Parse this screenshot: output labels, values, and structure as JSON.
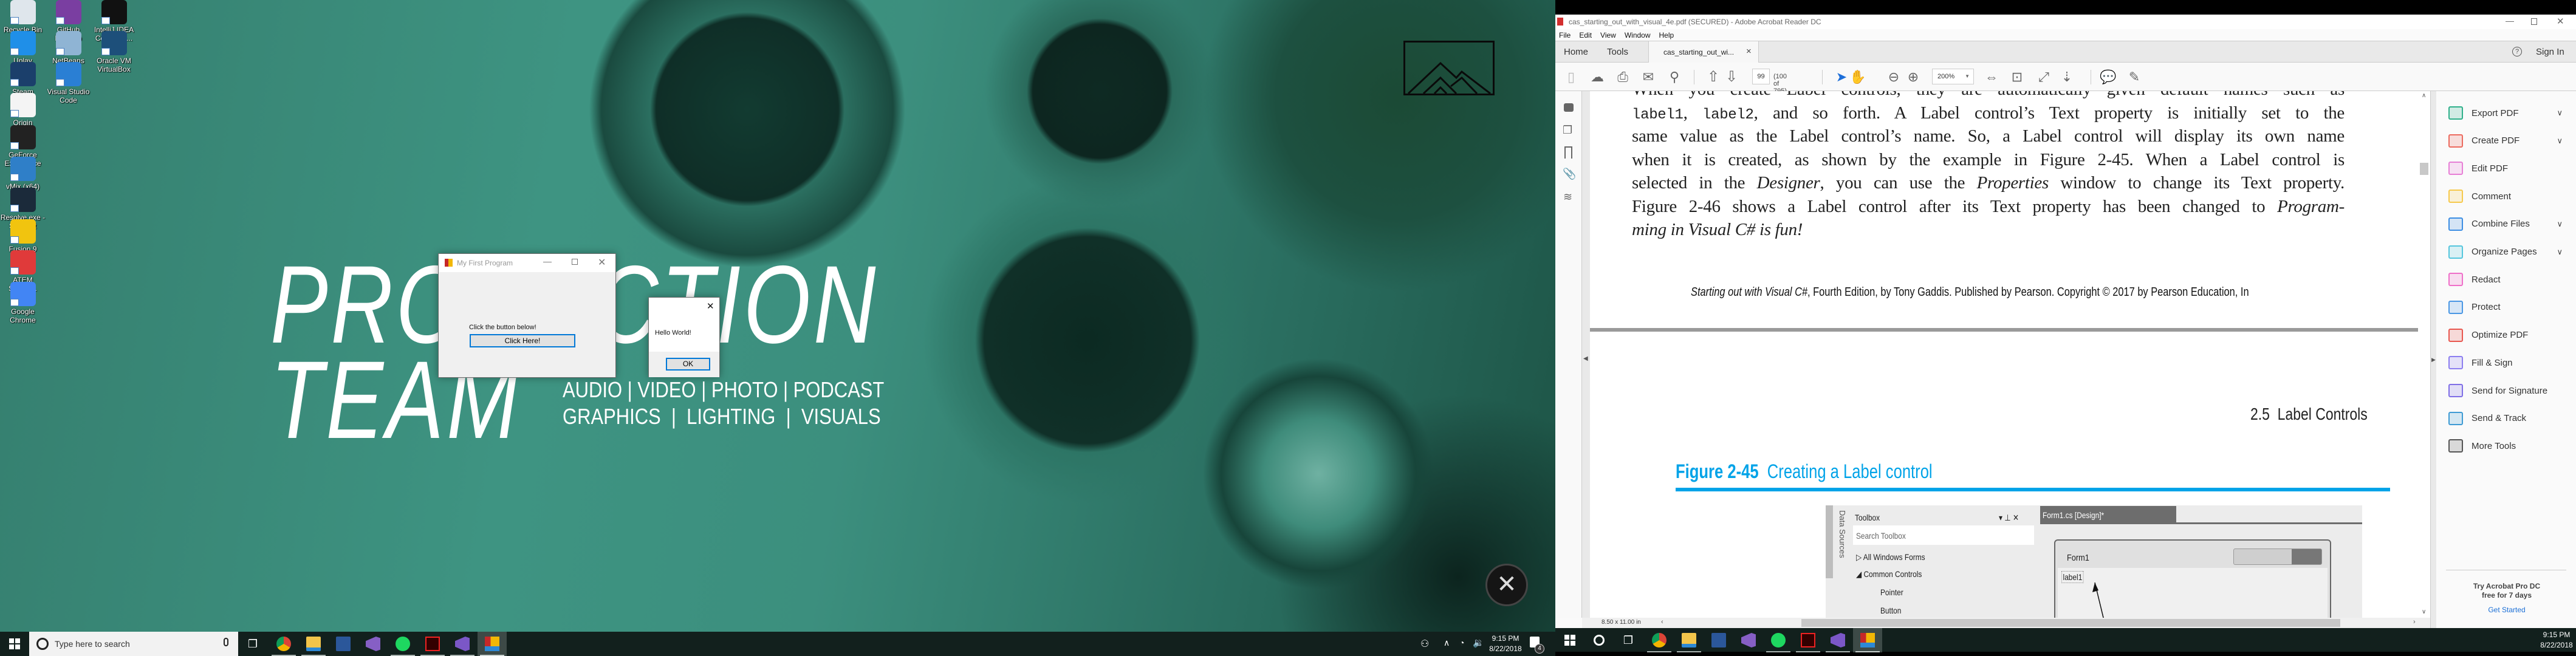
{
  "left_monitor": {
    "desktop_icons": [
      [
        {
          "label": "Recycle Bin",
          "icon": "recycle-bin",
          "color": "#dfe6ec"
        },
        {
          "label": "Uplay",
          "icon": "uplay",
          "color": "#1f8fe8"
        },
        {
          "label": "Steam",
          "icon": "steam",
          "color": "#1b3f6b"
        },
        {
          "label": "Origin",
          "icon": "blank-file",
          "color": "#f4f4f4"
        },
        {
          "label": "GeForce Experience",
          "icon": "geforce",
          "color": "#222222"
        },
        {
          "label": "vMix (x64)",
          "icon": "vmix",
          "color": "#2f7fc8"
        },
        {
          "label": "Resolve.exe - Shortcut",
          "icon": "davinci-resolve",
          "color": "#1b2a3a"
        },
        {
          "label": "Fusion 9",
          "icon": "fusion",
          "color": "#f1c40f"
        },
        {
          "label": "ATEM Softwa...",
          "icon": "atem",
          "color": "#e03a3a"
        },
        {
          "label": "Google Chrome",
          "icon": "chrome",
          "color": "#4285f4"
        }
      ],
      [
        {
          "label": "GitHub Desktop",
          "icon": "github",
          "color": "#7a3ea1"
        },
        {
          "label": "NetBeans IDE 8.2",
          "icon": "netbeans",
          "color": "#8fb4d4"
        },
        {
          "label": "Visual Studio Code",
          "icon": "vscode",
          "color": "#2a7fd4"
        }
      ],
      [
        {
          "label": "IntelliJ IDEA Communi...",
          "icon": "intellij",
          "color": "#111111"
        },
        {
          "label": "Oracle VM VirtualBox",
          "icon": "virtualbox",
          "color": "#1d4f7a"
        }
      ]
    ],
    "wallpaper": {
      "title_line1": "PRODUCTION",
      "title_line2": "TEAM",
      "subtitle_line1": "AUDIO | VIDEO | PHOTO | PODCAST",
      "subtitle_line2": "GRAPHICS  |  LIGHTING  |  VISUALS",
      "logo": "mountains-logo"
    },
    "form_window": {
      "title": "My First Program",
      "label": "Click the button below!",
      "button": "Click Here!"
    },
    "message_box": {
      "text": "Hello World!",
      "ok": "OK"
    },
    "taskbar": {
      "search_placeholder": "Type here to search",
      "apps": [
        {
          "icon": "chrome",
          "running": true
        },
        {
          "icon": "file-explorer",
          "running": true
        },
        {
          "icon": "word",
          "running": false
        },
        {
          "icon": "visual-studio",
          "running": false
        },
        {
          "icon": "spotify",
          "running": true
        },
        {
          "icon": "acrobat",
          "running": true
        },
        {
          "icon": "visual-studio-2",
          "running": true
        },
        {
          "icon": "winforms-app",
          "running": true,
          "active": true
        }
      ],
      "time": "9:15 PM",
      "date": "8/22/2018",
      "notification_count": "4"
    }
  },
  "right_monitor": {
    "acrobat": {
      "window_title": "cas_starting_out_with_visual_4e.pdf (SECURED) - Adobe Acrobat Reader DC",
      "menu": [
        "File",
        "Edit",
        "View",
        "Window",
        "Help"
      ],
      "tabs": {
        "home": "Home",
        "tools": "Tools",
        "document": "cas_starting_out_wi...",
        "close": "×"
      },
      "sign_in": "Sign In",
      "toolbar": {
        "page_number": "99",
        "page_count": "(100 of 795)",
        "zoom": "200%"
      },
      "page1": {
        "lines": [
          [
            {
              "t": "When you create Label controls, they are automatically given default names such as",
              "s": ""
            }
          ],
          [
            {
              "t": "label1",
              "s": "mono"
            },
            {
              "t": ", ",
              "s": ""
            },
            {
              "t": "label2",
              "s": "mono"
            },
            {
              "t": ", and so forth. A Label control’s Text property is initially set to the",
              "s": ""
            }
          ],
          [
            {
              "t": "same value as the Label control’s name. So, a Label control will display its own name",
              "s": ""
            }
          ],
          [
            {
              "t": "when it is created, as shown by the example in Figure 2-45. When a Label control is",
              "s": ""
            }
          ],
          [
            {
              "t": "selected in the ",
              "s": ""
            },
            {
              "t": "Designer",
              "s": "it"
            },
            {
              "t": ", you can use the ",
              "s": ""
            },
            {
              "t": "Properties",
              "s": "it"
            },
            {
              "t": " window to change its Text property.",
              "s": ""
            }
          ],
          [
            {
              "t": "Figure 2-46 shows a Label control after its Text property has been changed to ",
              "s": ""
            },
            {
              "t": "Program-",
              "s": "it"
            }
          ],
          [
            {
              "t": "ming in Visual C# is fun!",
              "s": "it"
            }
          ]
        ],
        "footer_italic": "Starting out with Visual C#",
        "footer_rest": ", Fourth Edition, by Tony Gaddis. Published by Pearson. Copyright © 2017 by Pearson Education, In"
      },
      "page2": {
        "running_head": "2.5  Label Controls",
        "figure_number": "Figure 2-45",
        "figure_title": "Creating a Label control",
        "accent_color": "#00a3e8",
        "screenshot": {
          "data_sources": "Data Sources",
          "toolbox": "Toolbox",
          "search": "Search Toolbox",
          "items": [
            "▷ All Windows Forms",
            "◢ Common Controls",
            "Pointer",
            "Button"
          ],
          "design_tab": "Form1.cs [Design]*",
          "form_title": "Form1",
          "label": "label1"
        }
      },
      "status": "8.50 x 11.00 in",
      "tools": [
        {
          "label": "Export PDF",
          "color": "#2fb08a",
          "chevron": true
        },
        {
          "label": "Create PDF",
          "color": "#ec6a5e",
          "chevron": true
        },
        {
          "label": "Edit PDF",
          "color": "#e77fd6",
          "chevron": false
        },
        {
          "label": "Comment",
          "color": "#f6c94c",
          "chevron": false
        },
        {
          "label": "Combine Files",
          "color": "#3d8ee3",
          "chevron": true
        },
        {
          "label": "Organize Pages",
          "color": "#55c6dd",
          "chevron": true
        },
        {
          "label": "Redact",
          "color": "#ef6fc9",
          "chevron": false
        },
        {
          "label": "Protect",
          "color": "#4a97e4",
          "chevron": false
        },
        {
          "label": "Optimize PDF",
          "color": "#e8574f",
          "chevron": false
        },
        {
          "label": "Fill & Sign",
          "color": "#8c7ef0",
          "chevron": false
        },
        {
          "label": "Send for Signature",
          "color": "#7f6ee6",
          "chevron": false
        },
        {
          "label": "Send & Track",
          "color": "#3e9bd4",
          "chevron": false
        },
        {
          "label": "More Tools",
          "color": "#555555",
          "chevron": false
        }
      ],
      "promo": {
        "line1": "Try Acrobat Pro DC",
        "line2": "free for 7 days",
        "link": "Get Started"
      }
    },
    "taskbar": {
      "apps": [
        {
          "icon": "chrome",
          "running": true
        },
        {
          "icon": "file-explorer",
          "running": true
        },
        {
          "icon": "word",
          "running": false
        },
        {
          "icon": "visual-studio",
          "running": false
        },
        {
          "icon": "spotify",
          "running": true
        },
        {
          "icon": "acrobat",
          "running": true
        },
        {
          "icon": "visual-studio-2",
          "running": true
        },
        {
          "icon": "winforms-app",
          "running": true,
          "active": true
        }
      ],
      "time": "9:15 PM",
      "date": "8/22/2018"
    }
  }
}
